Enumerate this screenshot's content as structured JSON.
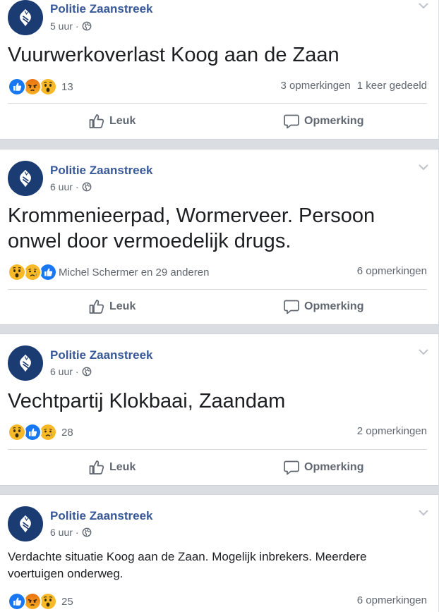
{
  "posts": [
    {
      "page_name": "Politie Zaanstreek",
      "time": "5 uur",
      "title": "Vuurwerkoverlast Koog aan de Zaan",
      "reactions": [
        "like",
        "angry",
        "wow"
      ],
      "reaction_text": "13",
      "comments": "3 opmerkingen",
      "shares": "1 keer gedeeld"
    },
    {
      "page_name": "Politie Zaanstreek",
      "time": "6 uur",
      "title_lines": [
        "Krommenieerpad, Wormerveer. Persoon",
        "onwel door vermoedelijk drugs."
      ],
      "reactions": [
        "wow",
        "sad",
        "like"
      ],
      "reaction_text": "Michel Schermer en 29 anderen",
      "comments": "6 opmerkingen"
    },
    {
      "page_name": "Politie Zaanstreek",
      "time": "6 uur",
      "title": "Vechtpartij Klokbaai, Zaandam",
      "reactions": [
        "wow",
        "like",
        "sad"
      ],
      "reaction_text": "28",
      "comments": "2 opmerkingen"
    },
    {
      "page_name": "Politie Zaanstreek",
      "time": "6 uur",
      "body": "Verdachte situatie Koog aan de Zaan. Mogelijk inbrekers. Meerdere voertuigen onderweg.",
      "reactions": [
        "like",
        "angry",
        "wow"
      ],
      "reaction_text": "25",
      "comments": "6 opmerkingen"
    }
  ],
  "actions": {
    "like": "Leuk",
    "comment": "Opmerking"
  },
  "dot": "·",
  "colors": {
    "page_name": "#385898",
    "avatar": "#1b3b73",
    "like": "#1877f2",
    "muted": "#606770"
  },
  "icons": [
    "police-logo-icon",
    "globe-icon",
    "chevron-down-icon",
    "like-reaction-icon",
    "angry-reaction-icon",
    "wow-reaction-icon",
    "sad-reaction-icon",
    "thumbs-up-icon",
    "comment-icon"
  ]
}
